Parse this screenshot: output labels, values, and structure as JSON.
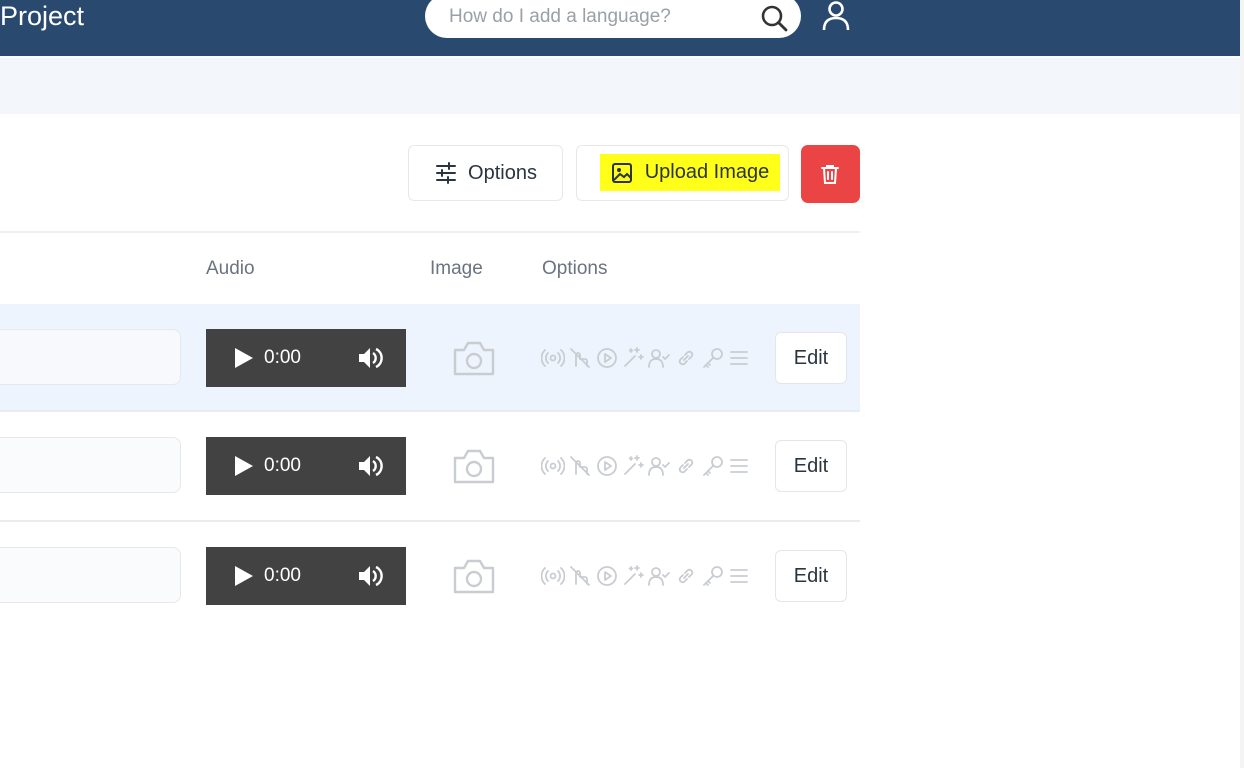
{
  "header": {
    "title": "Project",
    "search_placeholder": "How do I add a language?",
    "icons": [
      "search-icon",
      "user-icon"
    ]
  },
  "toolbar": {
    "options_label": "Options",
    "upload_label": "Upload Image",
    "highlight_color": "#ffff1a",
    "delete_color": "#ea4444",
    "icons": [
      "sliders-icon",
      "image-icon",
      "trash-icon"
    ]
  },
  "table": {
    "columns": [
      "Audio",
      "Image",
      "Options"
    ],
    "rows": [
      {
        "audio_time": "0:00",
        "edit_label": "Edit",
        "selected": true
      },
      {
        "audio_time": "0:00",
        "edit_label": "Edit",
        "selected": false
      },
      {
        "audio_time": "0:00",
        "edit_label": "Edit",
        "selected": false
      }
    ],
    "option_icons": [
      "broadcast-icon",
      "no-touch-icon",
      "play-circle-icon",
      "sparkle-icon",
      "user-check-icon",
      "link-icon",
      "key-icon",
      "menu-icon"
    ]
  },
  "colors": {
    "header_bg": "#294a6e",
    "subbar_bg": "#f3f6fb",
    "selected_row_bg": "#eef4fd",
    "audio_player_bg": "#424242"
  }
}
